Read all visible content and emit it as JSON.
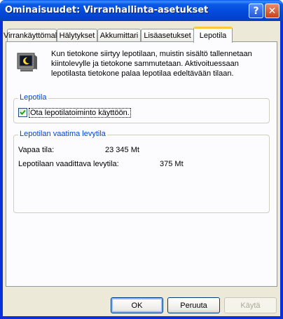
{
  "window": {
    "title": "Ominaisuudet: Virranhallinta-asetukset"
  },
  "titlebar": {
    "help_label": "?",
    "close_label": "✕"
  },
  "tabs": [
    {
      "label": "Virrankäyttömalli"
    },
    {
      "label": "Hälytykset"
    },
    {
      "label": "Akkumittari"
    },
    {
      "label": "Lisäasetukset"
    },
    {
      "label": "Lepotila"
    }
  ],
  "active_tab": "Lepotila",
  "intro": {
    "text": "Kun tietokone siirtyy lepotilaan, muistin sisältö tallennetaan kiintolevylle ja tietokone sammutetaan. Aktivoituessaan lepotilasta tietokone palaa lepotilaa edeltävään tilaan."
  },
  "hibernate_group": {
    "title": "Lepotila",
    "checkbox_label": "Ota lepotilatoiminto käyttöön.",
    "checked": true
  },
  "disk_group": {
    "title": "Lepotilan vaatima levytila",
    "free_label": "Vapaa tila:",
    "free_value": "23 345 Mt",
    "required_label": "Lepotilaan vaadittava levytila:",
    "required_value": "375 Mt"
  },
  "buttons": {
    "ok": "OK",
    "cancel": "Peruuta",
    "apply": "Käytä"
  },
  "colors": {
    "group_title": "#0046d5",
    "active_tab_accent": "#ffc83c",
    "titlebar": "#0348d8"
  }
}
